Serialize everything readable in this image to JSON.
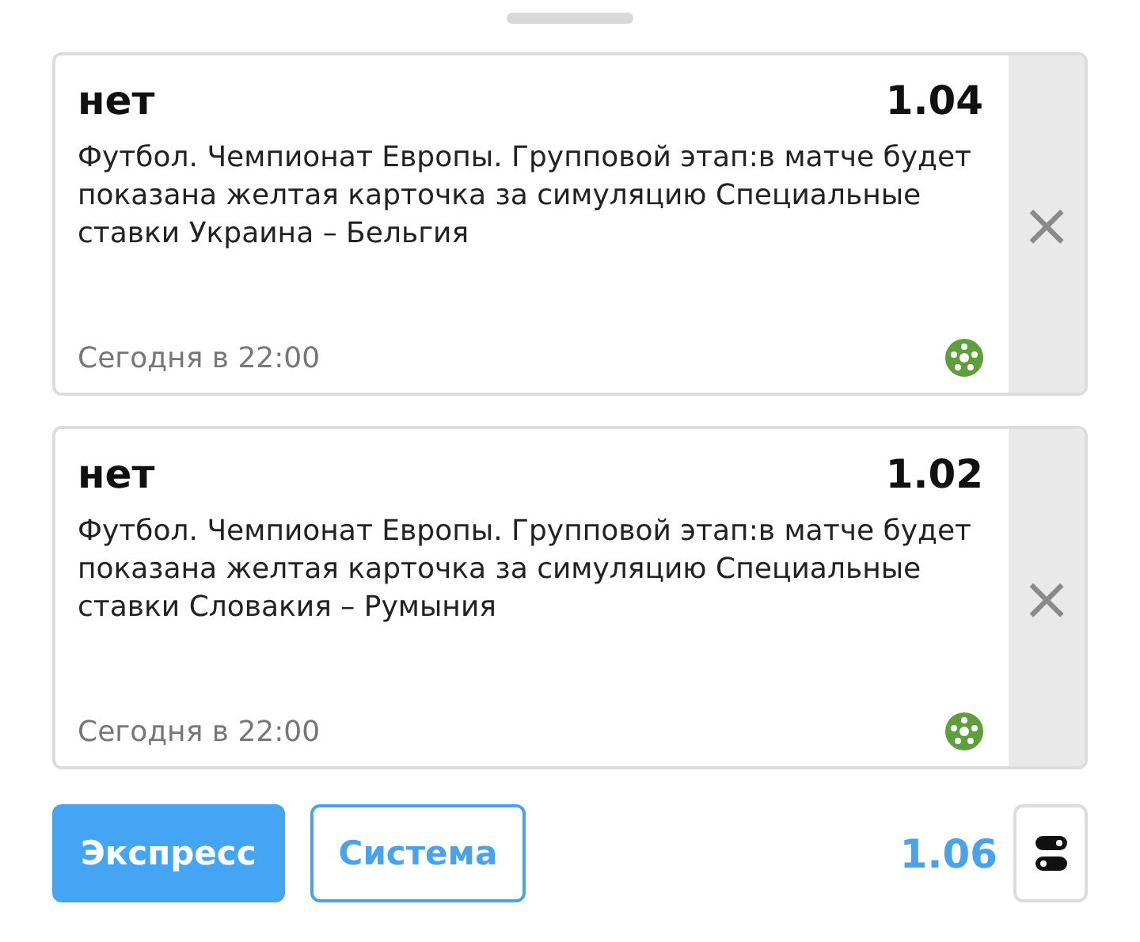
{
  "bets": [
    {
      "outcome": "нет",
      "odds": "1.04",
      "description": "Футбол. Чемпионат Европы. Групповой этап:в матче будет показана желтая карточка за симуляцию Специальные ставки Украина – Бельгия",
      "time": "Сегодня в 22:00",
      "remove": "×"
    },
    {
      "outcome": "нет",
      "odds": "1.02",
      "description": "Футбол. Чемпионат Европы. Групповой этап:в матче будет показана желтая карточка за симуляцию Специальные ставки Словакия – Румыния",
      "time": "Сегодня в 22:00",
      "remove": "×"
    }
  ],
  "modes": [
    {
      "label": "Экспресс",
      "selected": true
    },
    {
      "label": "Система",
      "selected": false
    }
  ],
  "total_odds": "1.06"
}
